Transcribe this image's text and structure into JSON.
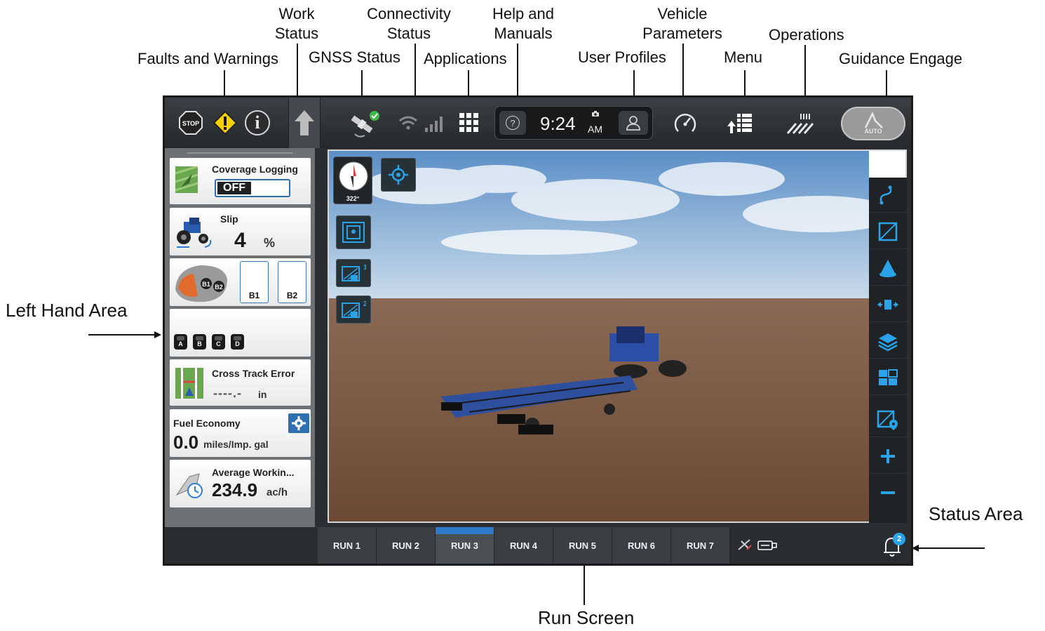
{
  "callouts": {
    "faults": "Faults and Warnings",
    "work_status": "Work\nStatus",
    "gnss": "GNSS Status",
    "connectivity": "Connectivity\nStatus",
    "applications": "Applications",
    "help": "Help and\nManuals",
    "user_profiles": "User Profiles",
    "vehicle_params": "Vehicle\nParameters",
    "menu": "Menu",
    "operations": "Operations",
    "guidance": "Guidance Engage",
    "left_hand_area": "Left Hand Area",
    "status_area": "Status Area",
    "run_screen": "Run Screen"
  },
  "topbar": {
    "stop_label": "STOP",
    "info_glyph": "i",
    "help_glyph": "?",
    "clock_time": "9:24",
    "clock_ampm": "AM",
    "auto_label": "AUTO",
    "icons": [
      "stop-icon",
      "warning-icon",
      "info-icon",
      "work-status-arrow-icon",
      "satellite-icon",
      "wifi-icon",
      "signal-bars-icon",
      "apps-grid-icon",
      "help-icon",
      "camera-icon",
      "user-icon",
      "speedometer-icon",
      "menu-icon",
      "operations-icon",
      "guidance-auto-icon"
    ]
  },
  "left_hand": {
    "coverage": {
      "title": "Coverage Logging",
      "toggle": "OFF"
    },
    "slip": {
      "title": "Slip",
      "value": "4",
      "unit": "%"
    },
    "buttons": {
      "b1": "B1",
      "b2": "B2",
      "hand_labels": [
        "B1",
        "B2"
      ]
    },
    "keys": [
      "A",
      "B",
      "C",
      "D"
    ],
    "cross_track": {
      "title": "Cross Track Error",
      "value": "----.-",
      "unit": "in"
    },
    "fuel": {
      "title": "Fuel Economy",
      "value": "0.0",
      "unit": "miles/Imp. gal"
    },
    "avg_working": {
      "title": "Average Workin...",
      "value": "234.9",
      "unit": "ac/h"
    }
  },
  "run_screen": {
    "compass_heading": "322°",
    "map_badges": [
      "1",
      "2"
    ]
  },
  "status_bar": {
    "tabs": [
      "RUN 1",
      "RUN 2",
      "RUN 3",
      "RUN 4",
      "RUN 5",
      "RUN 6",
      "RUN 7"
    ],
    "active_tab": "RUN 3",
    "notification_count": "2"
  },
  "colors": {
    "accent_blue": "#2e7bcb",
    "warning_yellow": "#f5d200",
    "panel_dark": "#2b2e31"
  }
}
